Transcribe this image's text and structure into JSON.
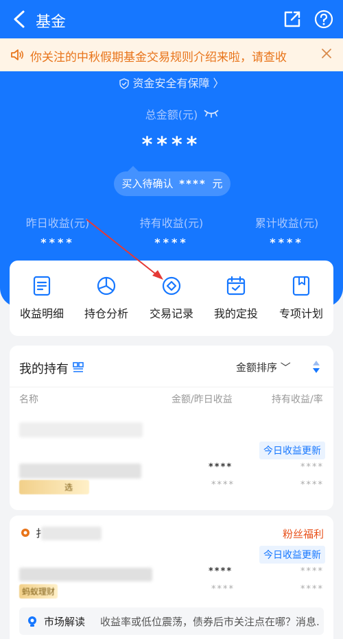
{
  "header": {
    "title": "基金"
  },
  "notice": {
    "text": "你关注的中秋假期基金交易规则介绍来啦，请查收"
  },
  "safety": {
    "text": "资金安全有保障 〉"
  },
  "summary": {
    "total_label": "总金额(元)",
    "total_value": "****",
    "pending_label": "买入待确认",
    "pending_value": "****",
    "pending_unit": "元"
  },
  "stats": [
    {
      "label": "昨日收益(元)",
      "value": "****"
    },
    {
      "label": "持有收益(元)",
      "value": "****"
    },
    {
      "label": "累计收益(元)",
      "value": "****"
    }
  ],
  "quick": [
    {
      "label": "收益明细",
      "icon": "document-icon"
    },
    {
      "label": "持仓分析",
      "icon": "pie-chart-icon"
    },
    {
      "label": "交易记录",
      "icon": "diamond-circle-icon"
    },
    {
      "label": "我的定投",
      "icon": "calendar-check-icon"
    },
    {
      "label": "专项计划",
      "icon": "bookmark-icon"
    }
  ],
  "holdings": {
    "title": "我的持有",
    "sort_label": "金额排序 ﹀",
    "col_name": "名称",
    "col_amount": "金额/昨日收益",
    "col_profit": "持有收益/率",
    "update_tag": "今日收益更新",
    "row1": {
      "tag_text": "选",
      "amount": "****",
      "yesterday": "****",
      "profit": "****",
      "rate": "****"
    }
  },
  "second": {
    "name_prefix": "扌",
    "fans_label": "粉丝福利",
    "update_tag": "今日收益更新",
    "brand": "蚂蚁理财",
    "amount": "****",
    "yesterday": "****",
    "profit": "****",
    "rate": "****"
  },
  "market": {
    "title": "市场解读",
    "text": "收益率或低位震荡，债券后市关注点在哪？消息..."
  },
  "colors": {
    "primary": "#1677ff",
    "notice_bg": "#fff4e6",
    "notice_text": "#e8741a",
    "accent_red": "#e8501a"
  }
}
